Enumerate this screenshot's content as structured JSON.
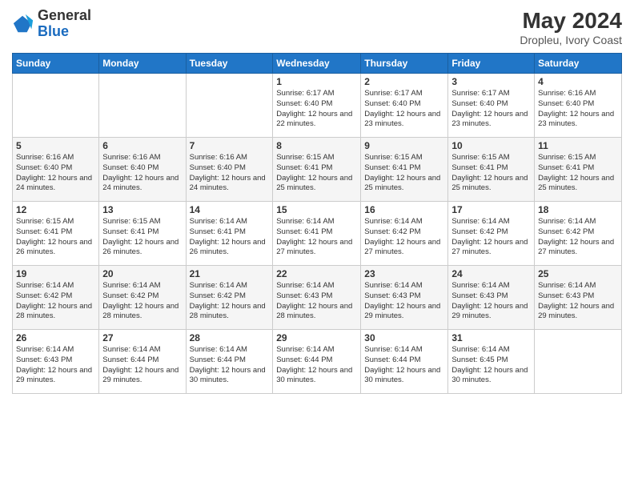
{
  "header": {
    "logo_general": "General",
    "logo_blue": "Blue",
    "title": "May 2024",
    "location": "Dropleu, Ivory Coast"
  },
  "days_of_week": [
    "Sunday",
    "Monday",
    "Tuesday",
    "Wednesday",
    "Thursday",
    "Friday",
    "Saturday"
  ],
  "weeks": [
    [
      {
        "day": "",
        "info": ""
      },
      {
        "day": "",
        "info": ""
      },
      {
        "day": "",
        "info": ""
      },
      {
        "day": "1",
        "info": "Sunrise: 6:17 AM\nSunset: 6:40 PM\nDaylight: 12 hours and 22 minutes."
      },
      {
        "day": "2",
        "info": "Sunrise: 6:17 AM\nSunset: 6:40 PM\nDaylight: 12 hours and 23 minutes."
      },
      {
        "day": "3",
        "info": "Sunrise: 6:17 AM\nSunset: 6:40 PM\nDaylight: 12 hours and 23 minutes."
      },
      {
        "day": "4",
        "info": "Sunrise: 6:16 AM\nSunset: 6:40 PM\nDaylight: 12 hours and 23 minutes."
      }
    ],
    [
      {
        "day": "5",
        "info": "Sunrise: 6:16 AM\nSunset: 6:40 PM\nDaylight: 12 hours and 24 minutes."
      },
      {
        "day": "6",
        "info": "Sunrise: 6:16 AM\nSunset: 6:40 PM\nDaylight: 12 hours and 24 minutes."
      },
      {
        "day": "7",
        "info": "Sunrise: 6:16 AM\nSunset: 6:40 PM\nDaylight: 12 hours and 24 minutes."
      },
      {
        "day": "8",
        "info": "Sunrise: 6:15 AM\nSunset: 6:41 PM\nDaylight: 12 hours and 25 minutes."
      },
      {
        "day": "9",
        "info": "Sunrise: 6:15 AM\nSunset: 6:41 PM\nDaylight: 12 hours and 25 minutes."
      },
      {
        "day": "10",
        "info": "Sunrise: 6:15 AM\nSunset: 6:41 PM\nDaylight: 12 hours and 25 minutes."
      },
      {
        "day": "11",
        "info": "Sunrise: 6:15 AM\nSunset: 6:41 PM\nDaylight: 12 hours and 25 minutes."
      }
    ],
    [
      {
        "day": "12",
        "info": "Sunrise: 6:15 AM\nSunset: 6:41 PM\nDaylight: 12 hours and 26 minutes."
      },
      {
        "day": "13",
        "info": "Sunrise: 6:15 AM\nSunset: 6:41 PM\nDaylight: 12 hours and 26 minutes."
      },
      {
        "day": "14",
        "info": "Sunrise: 6:14 AM\nSunset: 6:41 PM\nDaylight: 12 hours and 26 minutes."
      },
      {
        "day": "15",
        "info": "Sunrise: 6:14 AM\nSunset: 6:41 PM\nDaylight: 12 hours and 27 minutes."
      },
      {
        "day": "16",
        "info": "Sunrise: 6:14 AM\nSunset: 6:42 PM\nDaylight: 12 hours and 27 minutes."
      },
      {
        "day": "17",
        "info": "Sunrise: 6:14 AM\nSunset: 6:42 PM\nDaylight: 12 hours and 27 minutes."
      },
      {
        "day": "18",
        "info": "Sunrise: 6:14 AM\nSunset: 6:42 PM\nDaylight: 12 hours and 27 minutes."
      }
    ],
    [
      {
        "day": "19",
        "info": "Sunrise: 6:14 AM\nSunset: 6:42 PM\nDaylight: 12 hours and 28 minutes."
      },
      {
        "day": "20",
        "info": "Sunrise: 6:14 AM\nSunset: 6:42 PM\nDaylight: 12 hours and 28 minutes."
      },
      {
        "day": "21",
        "info": "Sunrise: 6:14 AM\nSunset: 6:42 PM\nDaylight: 12 hours and 28 minutes."
      },
      {
        "day": "22",
        "info": "Sunrise: 6:14 AM\nSunset: 6:43 PM\nDaylight: 12 hours and 28 minutes."
      },
      {
        "day": "23",
        "info": "Sunrise: 6:14 AM\nSunset: 6:43 PM\nDaylight: 12 hours and 29 minutes."
      },
      {
        "day": "24",
        "info": "Sunrise: 6:14 AM\nSunset: 6:43 PM\nDaylight: 12 hours and 29 minutes."
      },
      {
        "day": "25",
        "info": "Sunrise: 6:14 AM\nSunset: 6:43 PM\nDaylight: 12 hours and 29 minutes."
      }
    ],
    [
      {
        "day": "26",
        "info": "Sunrise: 6:14 AM\nSunset: 6:43 PM\nDaylight: 12 hours and 29 minutes."
      },
      {
        "day": "27",
        "info": "Sunrise: 6:14 AM\nSunset: 6:44 PM\nDaylight: 12 hours and 29 minutes."
      },
      {
        "day": "28",
        "info": "Sunrise: 6:14 AM\nSunset: 6:44 PM\nDaylight: 12 hours and 30 minutes."
      },
      {
        "day": "29",
        "info": "Sunrise: 6:14 AM\nSunset: 6:44 PM\nDaylight: 12 hours and 30 minutes."
      },
      {
        "day": "30",
        "info": "Sunrise: 6:14 AM\nSunset: 6:44 PM\nDaylight: 12 hours and 30 minutes."
      },
      {
        "day": "31",
        "info": "Sunrise: 6:14 AM\nSunset: 6:45 PM\nDaylight: 12 hours and 30 minutes."
      },
      {
        "day": "",
        "info": ""
      }
    ]
  ]
}
